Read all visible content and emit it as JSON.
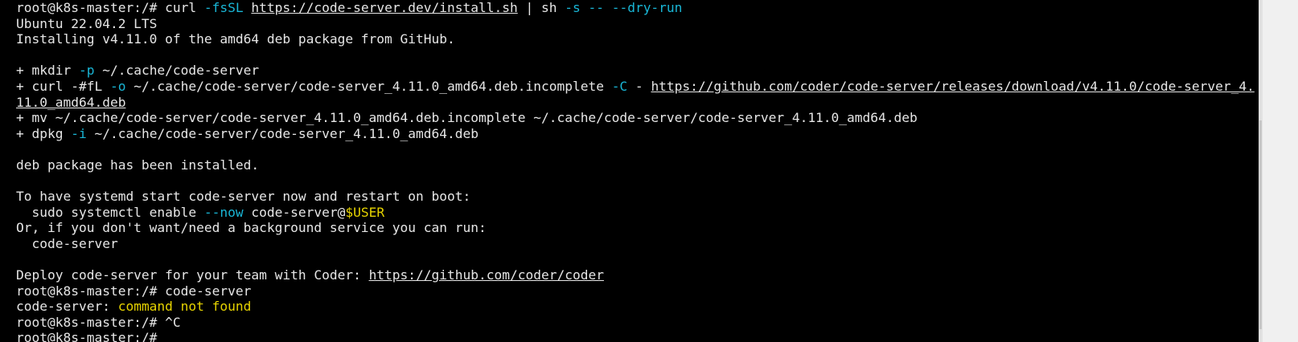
{
  "terminal": {
    "lines": [
      [
        {
          "text": "root@k8s-master:/# curl "
        },
        {
          "text": "-fsSL",
          "style": "cyan"
        },
        {
          "text": " "
        },
        {
          "text": "https://code-server.dev/install.sh",
          "style": "link"
        },
        {
          "text": " | sh "
        },
        {
          "text": "-s -- --dry-run",
          "style": "cyan"
        }
      ],
      [
        {
          "text": "Ubuntu 22.04.2 LTS"
        }
      ],
      [
        {
          "text": "Installing v4.11.0 of the amd64 deb package from GitHub."
        }
      ],
      [
        {
          "text": ""
        }
      ],
      [
        {
          "text": "+ mkdir "
        },
        {
          "text": "-p",
          "style": "cyan"
        },
        {
          "text": " ~/.cache/code-server"
        }
      ],
      [
        {
          "text": "+ curl -#fL "
        },
        {
          "text": "-o",
          "style": "cyan"
        },
        {
          "text": " ~/.cache/code-server/code-server_4.11.0_amd64.deb.incomplete "
        },
        {
          "text": "-C",
          "style": "cyan"
        },
        {
          "text": " - "
        },
        {
          "text": "https://github.com/coder/code-server/releases/download/v4.11.0/code-server_4.",
          "style": "link"
        }
      ],
      [
        {
          "text": "11.0_amd64.deb",
          "style": "link"
        }
      ],
      [
        {
          "text": "+ mv ~/.cache/code-server/code-server_4.11.0_amd64.deb.incomplete ~/.cache/code-server/code-server_4.11.0_amd64.deb"
        }
      ],
      [
        {
          "text": "+ dpkg "
        },
        {
          "text": "-i",
          "style": "cyan"
        },
        {
          "text": " ~/.cache/code-server/code-server_4.11.0_amd64.deb"
        }
      ],
      [
        {
          "text": ""
        }
      ],
      [
        {
          "text": "deb package has been installed."
        }
      ],
      [
        {
          "text": ""
        }
      ],
      [
        {
          "text": "To have systemd start code-server now and restart on boot:"
        }
      ],
      [
        {
          "text": "  sudo systemctl enable "
        },
        {
          "text": "--now",
          "style": "cyan"
        },
        {
          "text": " code-server@"
        },
        {
          "text": "$USER",
          "style": "yellow"
        }
      ],
      [
        {
          "text": "Or, if you don't want/need a background service you can run:"
        }
      ],
      [
        {
          "text": "  code-server"
        }
      ],
      [
        {
          "text": ""
        }
      ],
      [
        {
          "text": "Deploy code-server for your team with Coder: "
        },
        {
          "text": "https://github.com/coder/coder",
          "style": "link"
        }
      ],
      [
        {
          "text": "root@k8s-master:/# code-server"
        }
      ],
      [
        {
          "text": "code-server: "
        },
        {
          "text": "command not found",
          "style": "yellow"
        }
      ],
      [
        {
          "text": "root@k8s-master:/# ^C"
        }
      ],
      [
        {
          "text": "root@k8s-master:/# "
        }
      ]
    ]
  },
  "colors": {
    "background": "#000000",
    "foreground": "#e6e6e6",
    "option_cyan": "#19b6d6",
    "highlight_yellow": "#e6d300"
  }
}
